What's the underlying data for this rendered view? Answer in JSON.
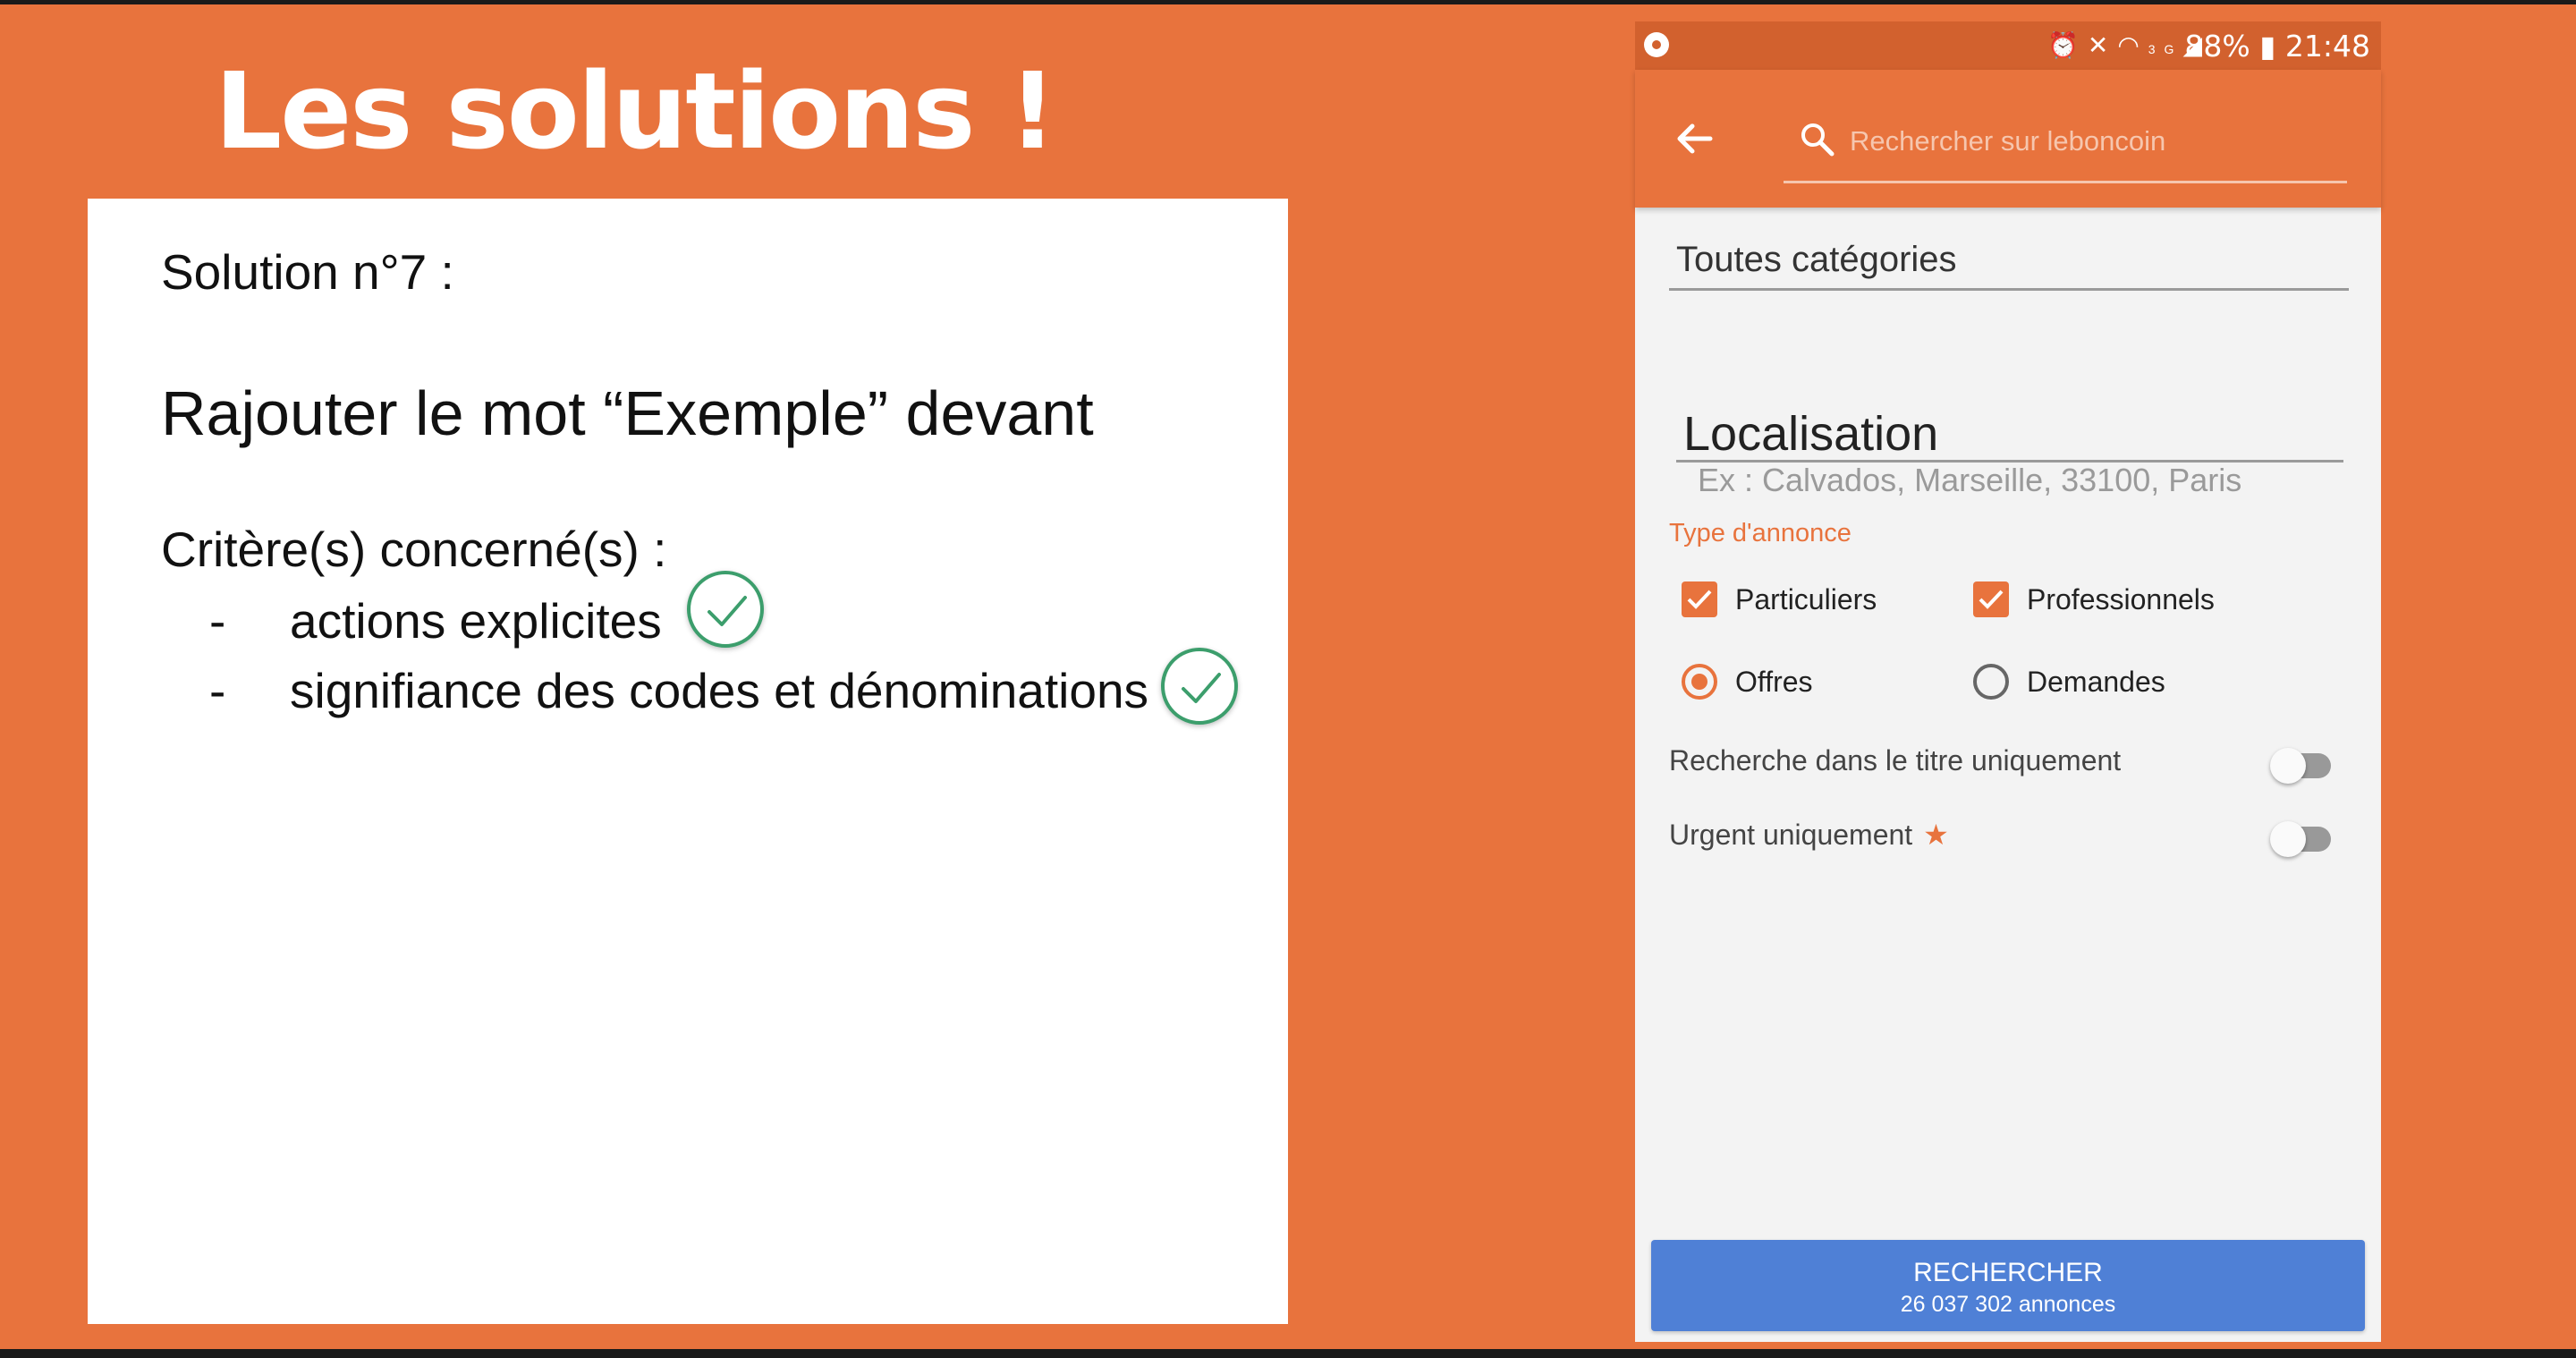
{
  "slide": {
    "title": "Les solutions !",
    "solution_title": "Solution n°7 :",
    "solution_description": "Rajouter le mot “Exemple” devant",
    "criteria_title": "Critère(s) concerné(s) :",
    "criteria": [
      {
        "dash": "-",
        "text": "actions explicites",
        "checked": true
      },
      {
        "dash": "-",
        "text": "signifiance des codes et dénominations",
        "checked": true
      }
    ]
  },
  "phone": {
    "status_bar": {
      "battery": "88%",
      "time": "21:48",
      "network": "3G",
      "icons": [
        "camera-icon",
        "alarm-icon",
        "mute-icon",
        "wifi-icon",
        "signal-icon",
        "battery-icon"
      ]
    },
    "search": {
      "placeholder": "Rechercher sur leboncoin"
    },
    "category_field": "Toutes catégories",
    "location_field": "Localisation",
    "location_hint": "Ex : Calvados, Marseille, 33100, Paris",
    "type_label": "Type d'annonce",
    "checkboxes": [
      {
        "label": "Particuliers",
        "checked": true
      },
      {
        "label": "Professionnels",
        "checked": true
      }
    ],
    "radios": [
      {
        "label": "Offres",
        "selected": true
      },
      {
        "label": "Demandes",
        "selected": false
      }
    ],
    "toggles": [
      {
        "label": "Recherche dans le titre uniquement",
        "on": false
      },
      {
        "label": "Urgent uniquement",
        "on": false
      }
    ],
    "button": {
      "label": "RECHERCHER",
      "count": "26 037 302 annonces"
    }
  },
  "colors": {
    "accent": "#E8733D",
    "status_bar": "#D2612E",
    "button": "#4F80D6",
    "check": "#3C9E6C"
  }
}
